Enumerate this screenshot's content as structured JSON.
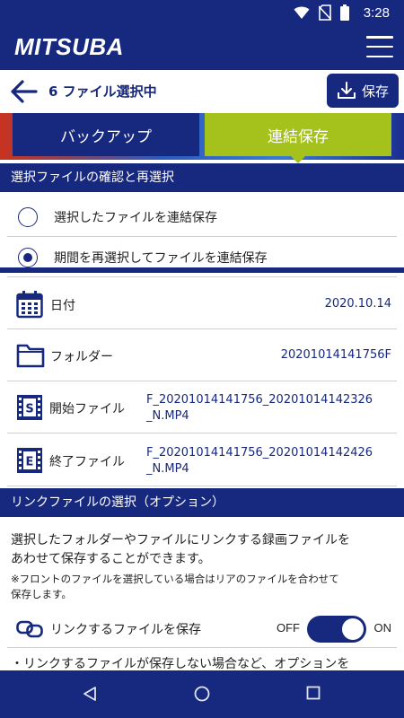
{
  "status_bar": {
    "time": "3:28",
    "icons": [
      "wifi-icon",
      "no-sim-icon",
      "battery-icon"
    ]
  },
  "app_bar": {
    "brand": "MITSUBA",
    "menu_icon": "hamburger-menu-icon"
  },
  "sub_header": {
    "title": "6 ファイル選択中",
    "save_label": "保存"
  },
  "tabs": [
    {
      "label": "バックアップ",
      "active": false
    },
    {
      "label": "連結保存",
      "active": true
    }
  ],
  "section_reselect": {
    "header": "選択ファイルの確認と再選択",
    "options": [
      {
        "label": "選択したファイルを連結保存",
        "checked": false
      },
      {
        "label": "期間を再選択してファイルを連結保存",
        "checked": true
      }
    ]
  },
  "details": {
    "date_label": "日付",
    "date_value": "2020.10.14",
    "folder_label": "フォルダー",
    "folder_value": "20201014141756F",
    "start_label": "開始ファイル",
    "start_value_line1": "F_20201014141756_20201014142326",
    "start_value_line2": "_N.MP4",
    "end_label": "終了ファイル",
    "end_value_line1": "F_20201014141756_20201014142426",
    "end_value_line2": "_N.MP4",
    "start_badge": "S",
    "end_badge": "E"
  },
  "section_link": {
    "header": "リンクファイルの選択（オプション）",
    "desc_line1": "選択したフォルダーやファイルにリンクする録画ファイルを",
    "desc_line2": "あわせて保存することができます。",
    "note_line1": "※フロントのファイルを選択している場合はリアのファイルを合わせて",
    "note_line2": "保存します。",
    "toggle_label": "リンクするファイルを保存",
    "off_label": "OFF",
    "on_label": "ON",
    "toggle_on": true,
    "bullet": "・リンクするファイルが保存しない場合など、オプションを"
  },
  "colors": {
    "primary": "#17287f",
    "accent_green": "#a5c21c"
  }
}
